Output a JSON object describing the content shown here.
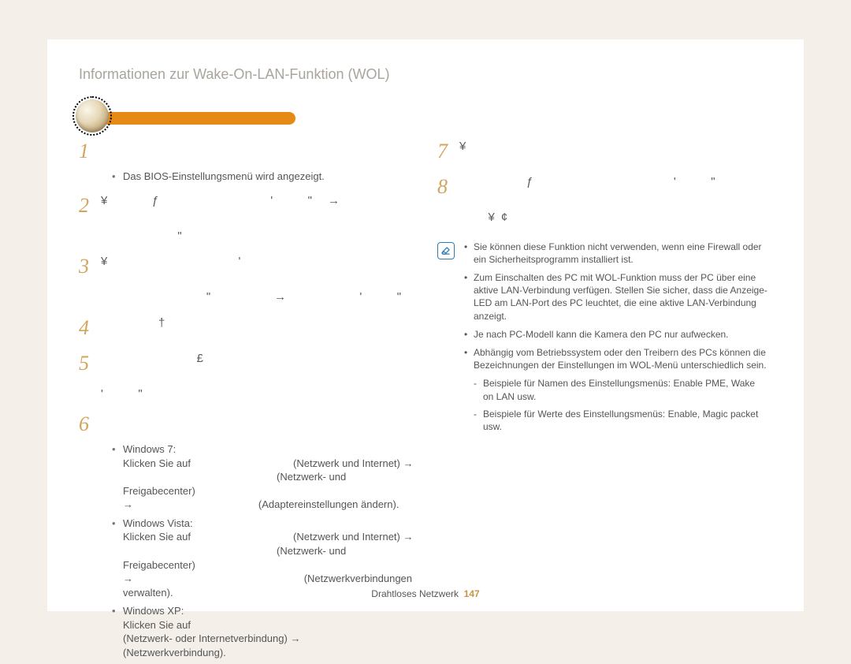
{
  "header": {
    "title": "Informationen zur Wake-On-LAN-Funktion (WOL)"
  },
  "left": {
    "step1_sub": "Das BIOS-Einstellungsmenü wird angezeigt.",
    "win7_label": "Windows 7:",
    "win7_click": "Klicken Sie auf",
    "win7_net_internet": "(Netzwerk und Internet)",
    "win7_net_freigabe": "(Netzwerk- und Freigabecenter)",
    "win7_adapter": "(Adaptereinstellungen ändern).",
    "vista_label": "Windows Vista:",
    "vista_click": "Klicken Sie auf",
    "vista_net_internet": "(Netzwerk und Internet)",
    "vista_net_freigabe": "(Netzwerk- und Freigabecenter)",
    "vista_netzverb": "(Netzwerkverbindungen verwalten).",
    "xp_label": "Windows XP:",
    "xp_click": "Klicken Sie auf",
    "xp_netconn": "(Netzwerk- oder Internetverbindung)",
    "xp_netverb": "(Netzwerkverbindung)."
  },
  "right": {
    "note1": "Sie können diese Funktion nicht verwenden, wenn eine Firewall oder ein Sicherheitsprogramm installiert ist.",
    "note2": "Zum Einschalten des PC mit WOL-Funktion muss der PC über eine aktive LAN-Verbindung verfügen. Stellen Sie sicher, dass die Anzeige-LED am LAN-Port des PC leuchtet, die eine aktive LAN-Verbindung anzeigt.",
    "note3": "Je nach PC-Modell kann die Kamera den PC nur aufwecken.",
    "note4": "Abhängig vom Betriebssystem oder den Treibern des PCs können die Bezeichnungen der Einstellungen im WOL-Menü unterschiedlich sein.",
    "note4a": "Beispiele für Namen des Einstellungsmenüs: Enable PME, Wake on LAN usw.",
    "note4b": "Beispiele für Werte des Einstellungsmenüs: Enable, Magic packet usw."
  },
  "footer": {
    "label": "Drahtloses Netzwerk",
    "page": "147"
  },
  "steps": {
    "s1": "1",
    "s2": "2",
    "s3": "3",
    "s4": "4",
    "s5": "5",
    "s6": "6",
    "s7": "7",
    "s8": "8"
  },
  "arrow": "→"
}
